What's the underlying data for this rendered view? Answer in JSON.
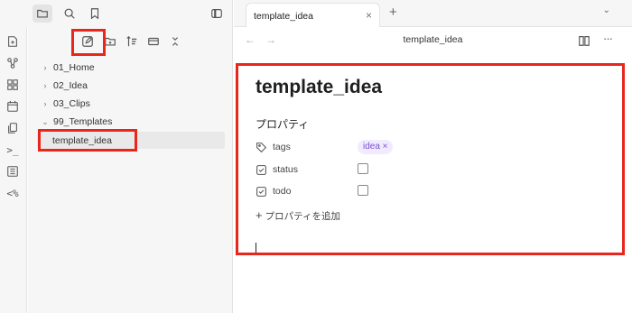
{
  "top_left": {
    "icons": [
      "folder-icon",
      "search-icon",
      "bookmark-icon",
      "sidebar-toggle-icon"
    ]
  },
  "ribbon": {
    "icons": [
      "new-note-icon",
      "graph-icon",
      "canvas-icon",
      "calendar-icon",
      "copy-icon",
      "terminal-icon",
      "list-icon",
      "code-icon"
    ],
    "code_icon_text": "<%",
    "terminal_icon_text": ">_"
  },
  "sidebar": {
    "tools": [
      "new-note-icon",
      "new-folder-icon",
      "sort-icon",
      "collapse-icon",
      "expand-icon"
    ],
    "tree": [
      {
        "label": "01_Home",
        "type": "folder",
        "expanded": false
      },
      {
        "label": "02_Idea",
        "type": "folder",
        "expanded": false
      },
      {
        "label": "03_Clips",
        "type": "folder",
        "expanded": false
      },
      {
        "label": "99_Templates",
        "type": "folder",
        "expanded": true
      },
      {
        "label": "template_idea",
        "type": "file",
        "selected": true
      }
    ]
  },
  "tabbar": {
    "tab_label": "template_idea",
    "close": "×",
    "new_tab": "+",
    "menu": "⌄"
  },
  "view_header": {
    "back": "←",
    "forward": "→",
    "title": "template_idea",
    "more": "···"
  },
  "editor": {
    "title": "template_idea",
    "properties_heading": "プロパティ",
    "properties": [
      {
        "key": "tags",
        "type": "tag",
        "value": "idea ×"
      },
      {
        "key": "status",
        "type": "checkbox",
        "checked": false
      },
      {
        "key": "todo",
        "type": "checkbox",
        "checked": false
      }
    ],
    "add_property": "プロパティを追加",
    "add_plus": "+"
  },
  "colors": {
    "highlight": "#e8261c",
    "tag_bg": "#f1ebff",
    "tag_text": "#7a4fd1",
    "sidebar_bg": "#f6f6f6"
  }
}
